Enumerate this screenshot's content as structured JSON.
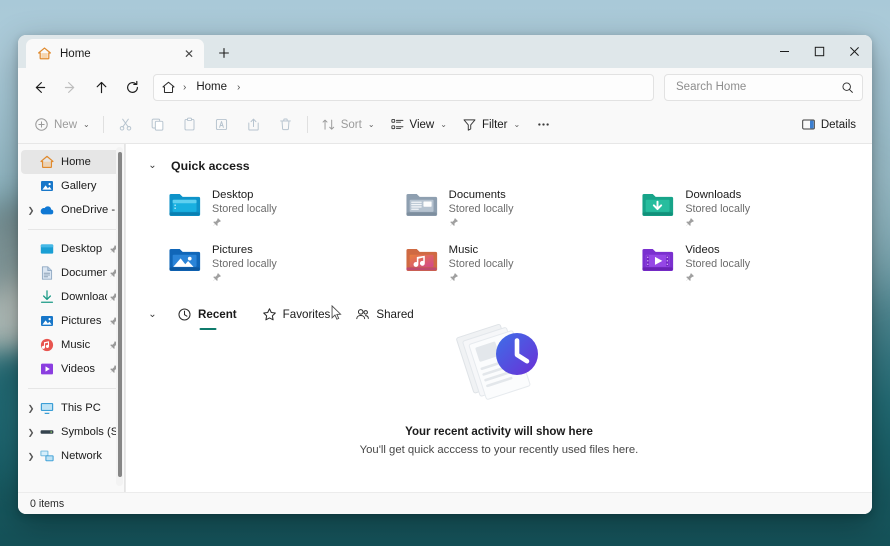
{
  "window": {
    "tab": {
      "title": "Home",
      "icon": "home-icon",
      "close_label": "✕"
    },
    "new_tab_label": "＋",
    "controls": {
      "minimize": "minimize-icon",
      "maximize": "maximize-icon",
      "close": "close-icon"
    }
  },
  "address_bar": {
    "back": "back-arrow-icon",
    "forward": "forward-arrow-icon",
    "up": "up-arrow-icon",
    "refresh": "refresh-icon",
    "breadcrumb": {
      "home_icon": "home-icon",
      "sep1": "›",
      "label": "Home",
      "sep2": "›"
    },
    "search": {
      "placeholder": "Search Home",
      "value": "",
      "icon": "search-icon"
    }
  },
  "command_bar": {
    "new_label": "New",
    "new_chevron": "⌄",
    "cut": "cut-icon",
    "copy": "copy-icon",
    "paste": "paste-icon",
    "rename": "rename-icon",
    "share": "share-icon",
    "delete": "delete-icon",
    "sort_label": "Sort",
    "sort_chevron": "⌄",
    "view_label": "View",
    "view_chevron": "⌄",
    "filter_label": "Filter",
    "filter_chevron": "⌄",
    "more_label": "•••",
    "details_label": "Details"
  },
  "sidebar": {
    "top_items": [
      {
        "label": "Home",
        "icon": "home-icon",
        "selected": true,
        "expandable": false,
        "pinned": false
      },
      {
        "label": "Gallery",
        "icon": "gallery-icon",
        "selected": false,
        "expandable": false,
        "pinned": false
      },
      {
        "label": "OneDrive - Perso",
        "icon": "onedrive-icon",
        "selected": false,
        "expandable": true,
        "pinned": false
      }
    ],
    "pinned_items": [
      {
        "label": "Desktop",
        "icon": "desktop-folder-icon",
        "pinned": true
      },
      {
        "label": "Documents",
        "icon": "documents-folder-icon",
        "pinned": true
      },
      {
        "label": "Downloads",
        "icon": "downloads-icon",
        "pinned": true
      },
      {
        "label": "Pictures",
        "icon": "pictures-folder-icon",
        "pinned": true
      },
      {
        "label": "Music",
        "icon": "music-icon",
        "pinned": true
      },
      {
        "label": "Videos",
        "icon": "videos-icon",
        "pinned": true
      }
    ],
    "device_items": [
      {
        "label": "This PC",
        "icon": "this-pc-icon",
        "expandable": true
      },
      {
        "label": "Symbols (S:)",
        "icon": "drive-icon",
        "expandable": true
      },
      {
        "label": "Network",
        "icon": "network-icon",
        "expandable": true
      }
    ],
    "chevron_glyph": "❯",
    "pin_glyph": "pin-icon"
  },
  "main": {
    "quick_access": {
      "chevron": "⌄",
      "title": "Quick access",
      "tiles": [
        {
          "name": "Desktop",
          "subtitle": "Stored locally",
          "icon": "desktop-folder-icon",
          "pinned": true
        },
        {
          "name": "Documents",
          "subtitle": "Stored locally",
          "icon": "documents-folder-icon",
          "pinned": true
        },
        {
          "name": "Downloads",
          "subtitle": "Stored locally",
          "icon": "downloads-folder-icon",
          "pinned": true
        },
        {
          "name": "Pictures",
          "subtitle": "Stored locally",
          "icon": "pictures-folder-icon",
          "pinned": true
        },
        {
          "name": "Music",
          "subtitle": "Stored locally",
          "icon": "music-folder-icon",
          "pinned": true
        },
        {
          "name": "Videos",
          "subtitle": "Stored locally",
          "icon": "videos-folder-icon",
          "pinned": true
        }
      ]
    },
    "recent_section": {
      "chevron": "⌄",
      "tabs": [
        {
          "label": "Recent",
          "icon": "clock-icon",
          "active": true
        },
        {
          "label": "Favorites",
          "icon": "star-icon",
          "active": false
        },
        {
          "label": "Shared",
          "icon": "people-icon",
          "active": false
        }
      ]
    },
    "empty_state": {
      "illustration": "recent-activity-illustration",
      "title": "Your recent activity will show here",
      "subtitle": "You'll get quick acccess to your recently used files here."
    }
  },
  "status_bar": {
    "items_count": "0 items"
  },
  "colors": {
    "accent_teal": "#0f7b6c",
    "window_bg": "#f9f9f9",
    "titlebar_bg": "#dfe7ea",
    "selected_row": "#e6e6e6"
  }
}
